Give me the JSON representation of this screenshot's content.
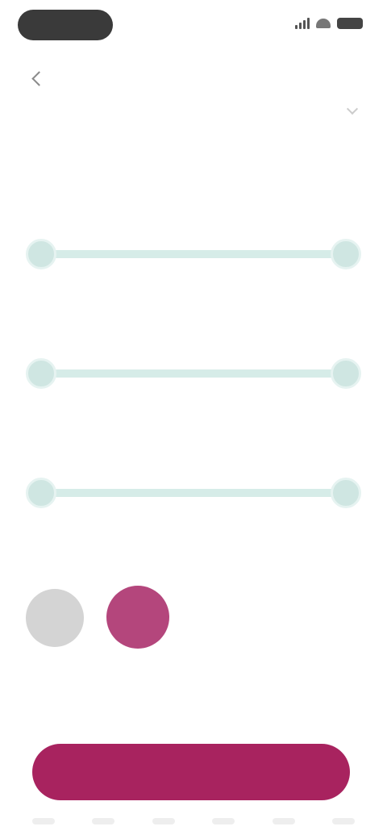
{
  "status_bar": {
    "icons": [
      "signal-icon",
      "wifi-icon",
      "battery-icon"
    ]
  },
  "header": {
    "title": "",
    "action": "",
    "subtitle": ""
  },
  "tabs": [
    {
      "label": ""
    },
    {
      "label": ""
    },
    {
      "label": ""
    }
  ],
  "sections": [
    {
      "label": "",
      "value": ""
    },
    {
      "label": "",
      "value": ""
    },
    {
      "label": "",
      "value": ""
    }
  ],
  "color": {
    "label": "",
    "more": "",
    "swatches": [
      {
        "color": "#d4d4d4",
        "caption": ""
      },
      {
        "color": "#b4467c",
        "caption": ""
      }
    ]
  },
  "footnote": "",
  "apply_button": {
    "label": ""
  },
  "colors": {
    "accent": "#a8235f",
    "slider": "#d6ece8"
  }
}
